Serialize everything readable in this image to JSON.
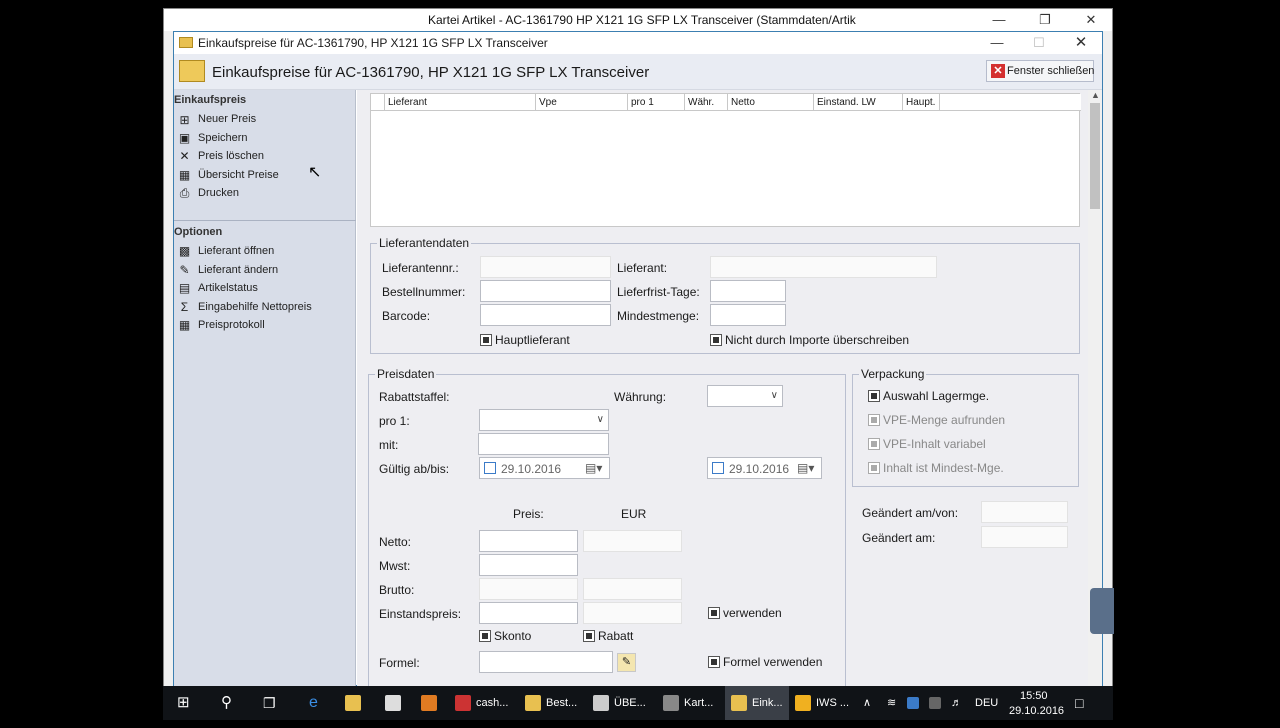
{
  "bg_window": {
    "title": "Kartei Artikel - AC-1361790 HP X121 1G SFP LX Transceiver (Stammdaten/Artik"
  },
  "dialog": {
    "title": "Einkaufspreise für AC-1361790, HP X121 1G SFP LX Transceiver",
    "header": "Einkaufspreise für AC-1361790, HP X121 1G SFP LX Transceiver",
    "close_button": "Fenster schließen"
  },
  "sidebar": {
    "section1": "Einkaufspreis",
    "items1": [
      "Neuer Preis",
      "Speichern",
      "Preis löschen",
      "Übersicht Preise",
      "Drucken"
    ],
    "section2": "Optionen",
    "items2": [
      "Lieferant öffnen",
      "Lieferant ändern",
      "Artikelstatus",
      "Eingabehilfe Nettopreis",
      "Preisprotokoll"
    ]
  },
  "table": {
    "columns": [
      "Lieferant",
      "Vpe",
      "pro 1",
      "Währ.",
      "Netto",
      "Einstand. LW",
      "Haupt."
    ]
  },
  "lieferantendaten": {
    "title": "Lieferantendaten",
    "lieferantennr": "Lieferantennr.:",
    "lieferant": "Lieferant:",
    "bestellnummer": "Bestellnummer:",
    "lieferfrist": "Lieferfrist-Tage:",
    "barcode": "Barcode:",
    "mindestmenge": "Mindestmenge:",
    "hauptlieferant": "Hauptlieferant",
    "nicht_importe": "Nicht durch Importe überschreiben"
  },
  "preisdaten": {
    "title": "Preisdaten",
    "rabattstaffel": "Rabattstaffel:",
    "waehrung": "Währung:",
    "pro1": "pro 1:",
    "mit": "mit:",
    "gueltig": "Gültig ab/bis:",
    "date_from": "29.10.2016",
    "date_to": "29.10.2016",
    "preis": "Preis:",
    "eur": "EUR",
    "netto": "Netto:",
    "mwst": "Mwst:",
    "brutto": "Brutto:",
    "einstandspreis": "Einstandspreis:",
    "verwenden": "verwenden",
    "skonto": "Skonto",
    "rabatt": "Rabatt",
    "formel": "Formel:",
    "formel_verwenden": "Formel verwenden"
  },
  "verpackung": {
    "title": "Verpackung",
    "auswahl": "Auswahl Lagermge.",
    "vpe_menge": "VPE-Menge aufrunden",
    "vpe_inhalt": "VPE-Inhalt variabel",
    "inhalt_mindest": "Inhalt ist Mindest-Mge."
  },
  "geaendert": {
    "am_von": "Geändert am/von:",
    "am": "Geändert am:"
  },
  "taskbar": {
    "items": [
      "cash...",
      "Best...",
      "ÜBE...",
      "Kart...",
      "Eink...",
      "IWS ..."
    ],
    "lang": "DEU",
    "time": "15:50",
    "date": "29.10.2016"
  }
}
